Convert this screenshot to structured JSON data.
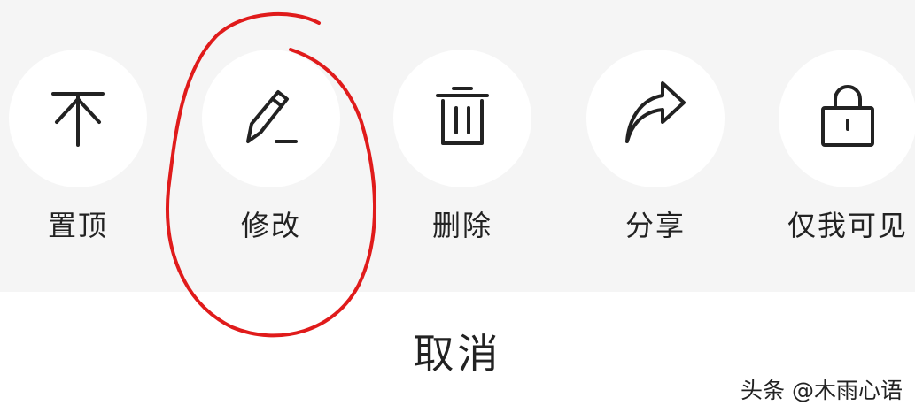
{
  "actions": [
    {
      "label": "置顶",
      "icon": "pin-to-top-icon"
    },
    {
      "label": "修改",
      "icon": "pencil-icon"
    },
    {
      "label": "删除",
      "icon": "trash-icon"
    },
    {
      "label": "分享",
      "icon": "share-arrow-icon"
    },
    {
      "label": "仅我可见",
      "icon": "lock-icon"
    }
  ],
  "cancel_label": "取消",
  "watermark": "头条 @木雨心语",
  "colors": {
    "panel_background": "#f5f5f5",
    "icon_stroke": "#222222",
    "annotation": "#e01b1b"
  }
}
